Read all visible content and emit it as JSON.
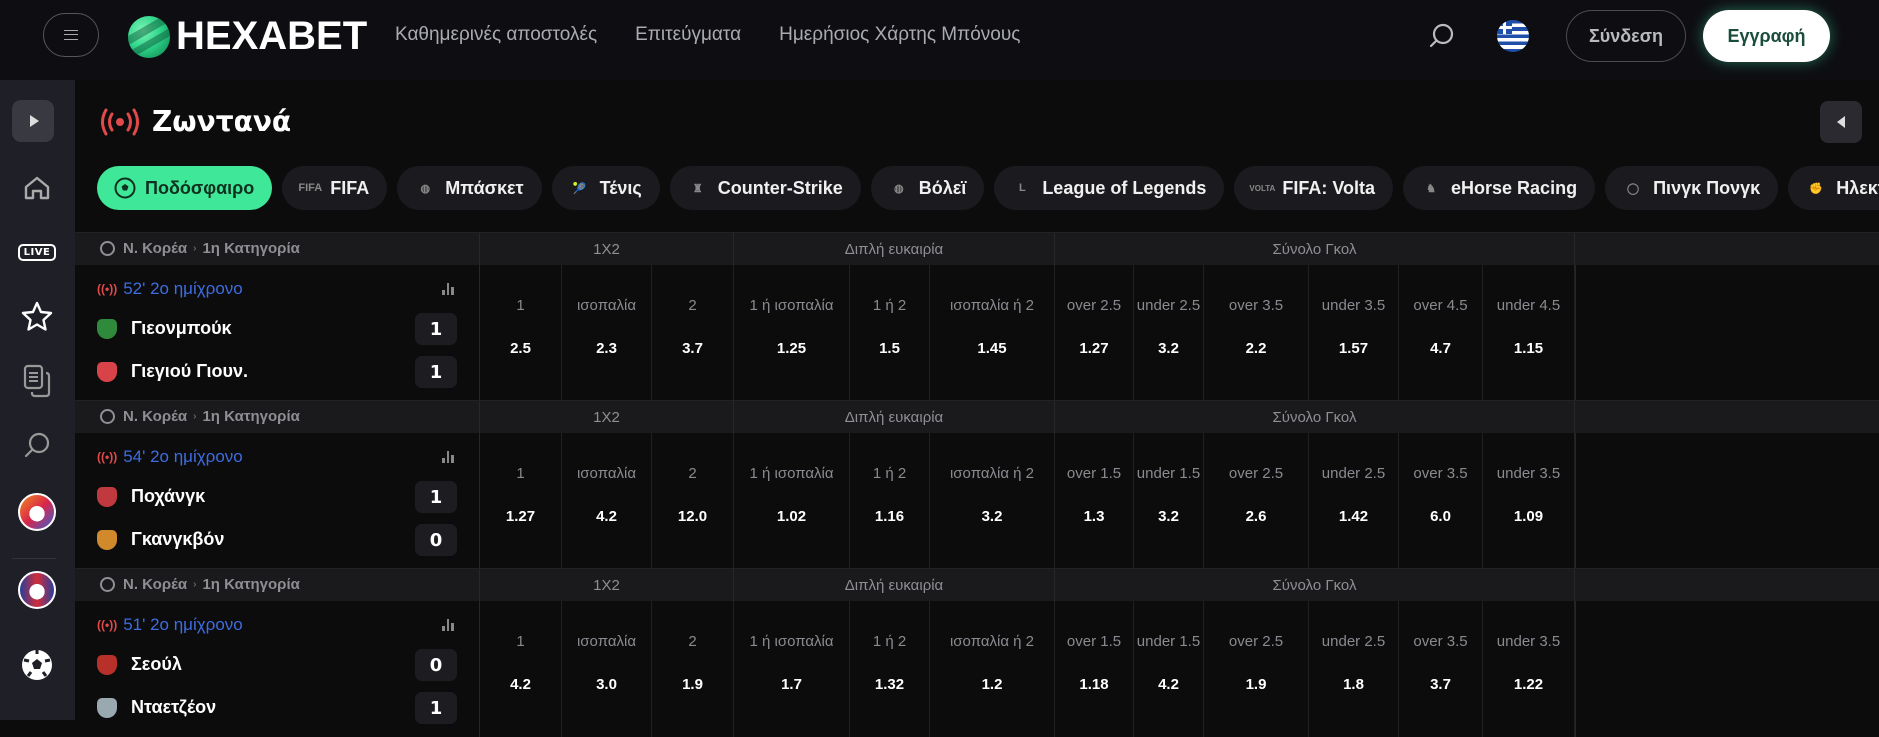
{
  "header": {
    "brand": "HEXABET",
    "nav": [
      "Καθημερινές αποστολές",
      "Επιτεύγματα",
      "Ημερήσιος Χάρτης Μπόνους"
    ],
    "login": "Σύνδεση",
    "register": "Εγγραφή",
    "icons": {
      "menu": "hamburger-icon",
      "search": "search-icon",
      "language": "greece-flag-icon"
    }
  },
  "sidebar": {
    "items": [
      {
        "name": "expand",
        "icon": "play-icon"
      },
      {
        "name": "home",
        "icon": "home-icon"
      },
      {
        "name": "live",
        "icon": "live-badge-icon",
        "label": "LIVE"
      },
      {
        "name": "favorites",
        "icon": "star-icon"
      },
      {
        "name": "betslip",
        "icon": "documents-icon"
      },
      {
        "name": "search",
        "icon": "search-icon"
      },
      {
        "name": "euro-cup-1",
        "icon": "trophy-icon"
      },
      {
        "name": "euro-cup-2",
        "icon": "trophy-icon"
      },
      {
        "name": "football",
        "icon": "soccer-ball-icon"
      }
    ]
  },
  "page": {
    "title": "Ζωντανά",
    "title_icon": "live-broadcast-icon",
    "accent": "#3ee898"
  },
  "sports": [
    {
      "label": "Ποδόσφαιρο",
      "icon": "soccer-ball-icon",
      "active": true
    },
    {
      "label": "FIFA",
      "icon": "fifa-icon",
      "active": false
    },
    {
      "label": "Μπάσκετ",
      "icon": "basketball-icon",
      "active": false
    },
    {
      "label": "Τένις",
      "icon": "tennis-icon",
      "active": false
    },
    {
      "label": "Counter-Strike",
      "icon": "counter-strike-icon",
      "active": false
    },
    {
      "label": "Βόλεϊ",
      "icon": "volleyball-icon",
      "active": false
    },
    {
      "label": "League of Legends",
      "icon": "lol-icon",
      "active": false
    },
    {
      "label": "FIFA: Volta",
      "icon": "fifa-volta-icon",
      "active": false
    },
    {
      "label": "eHorse Racing",
      "icon": "horse-icon",
      "active": false
    },
    {
      "label": "Πινγκ Πονγκ",
      "icon": "ping-pong-icon",
      "active": false
    },
    {
      "label": "Ηλεκτρ",
      "icon": "fist-icon",
      "active": false
    }
  ],
  "market_groups": [
    "1X2",
    "Διπλή ευκαιρία",
    "Σύνολο Γκολ"
  ],
  "events": [
    {
      "league": "Ν. Κορέα",
      "category": "1η Κατηγορία",
      "status": "52' 2ο ημίχρονο",
      "home": {
        "name": "Γιεονμπούκ",
        "score": "1",
        "crest_color": "#2f8a3c"
      },
      "away": {
        "name": "Γιεγιού Γιουν.",
        "score": "1",
        "crest_color": "#d8434a"
      },
      "odds": [
        {
          "label": "1",
          "value": "2.5"
        },
        {
          "label": "ισοπαλία",
          "value": "2.3"
        },
        {
          "label": "2",
          "value": "3.7"
        },
        {
          "label": "1 ή ισοπαλία",
          "value": "1.25"
        },
        {
          "label": "1 ή 2",
          "value": "1.5"
        },
        {
          "label": "ισοπαλία ή 2",
          "value": "1.45"
        },
        {
          "label": "over 2.5",
          "value": "1.27"
        },
        {
          "label": "under 2.5",
          "value": "3.2"
        },
        {
          "label": "over 3.5",
          "value": "2.2"
        },
        {
          "label": "under 3.5",
          "value": "1.57"
        },
        {
          "label": "over 4.5",
          "value": "4.7"
        },
        {
          "label": "under 4.5",
          "value": "1.15"
        }
      ]
    },
    {
      "league": "Ν. Κορέα",
      "category": "1η Κατηγορία",
      "status": "54' 2ο ημίχρονο",
      "home": {
        "name": "Ποχάνγκ",
        "score": "1",
        "crest_color": "#c0393f"
      },
      "away": {
        "name": "Γκανγκβόν",
        "score": "0",
        "crest_color": "#d08a2c"
      },
      "odds": [
        {
          "label": "1",
          "value": "1.27"
        },
        {
          "label": "ισοπαλία",
          "value": "4.2"
        },
        {
          "label": "2",
          "value": "12.0"
        },
        {
          "label": "1 ή ισοπαλία",
          "value": "1.02"
        },
        {
          "label": "1 ή 2",
          "value": "1.16"
        },
        {
          "label": "ισοπαλία ή 2",
          "value": "3.2"
        },
        {
          "label": "over 1.5",
          "value": "1.3"
        },
        {
          "label": "under 1.5",
          "value": "3.2"
        },
        {
          "label": "over 2.5",
          "value": "2.6"
        },
        {
          "label": "under 2.5",
          "value": "1.42"
        },
        {
          "label": "over 3.5",
          "value": "6.0"
        },
        {
          "label": "under 3.5",
          "value": "1.09"
        }
      ]
    },
    {
      "league": "Ν. Κορέα",
      "category": "1η Κατηγορία",
      "status": "51' 2ο ημίχρονο",
      "home": {
        "name": "Σεούλ",
        "score": "0",
        "crest_color": "#b8302a"
      },
      "away": {
        "name": "Νταετζέον",
        "score": "1",
        "crest_color": "#9aa8b0"
      },
      "odds": [
        {
          "label": "1",
          "value": "4.2"
        },
        {
          "label": "ισοπαλία",
          "value": "3.0"
        },
        {
          "label": "2",
          "value": "1.9"
        },
        {
          "label": "1 ή ισοπαλία",
          "value": "1.7"
        },
        {
          "label": "1 ή 2",
          "value": "1.32"
        },
        {
          "label": "ισοπαλία ή 2",
          "value": "1.2"
        },
        {
          "label": "over 1.5",
          "value": "1.18"
        },
        {
          "label": "under 1.5",
          "value": "4.2"
        },
        {
          "label": "over 2.5",
          "value": "1.9"
        },
        {
          "label": "under 2.5",
          "value": "1.8"
        },
        {
          "label": "over 3.5",
          "value": "3.7"
        },
        {
          "label": "under 3.5",
          "value": "1.22"
        }
      ]
    }
  ]
}
